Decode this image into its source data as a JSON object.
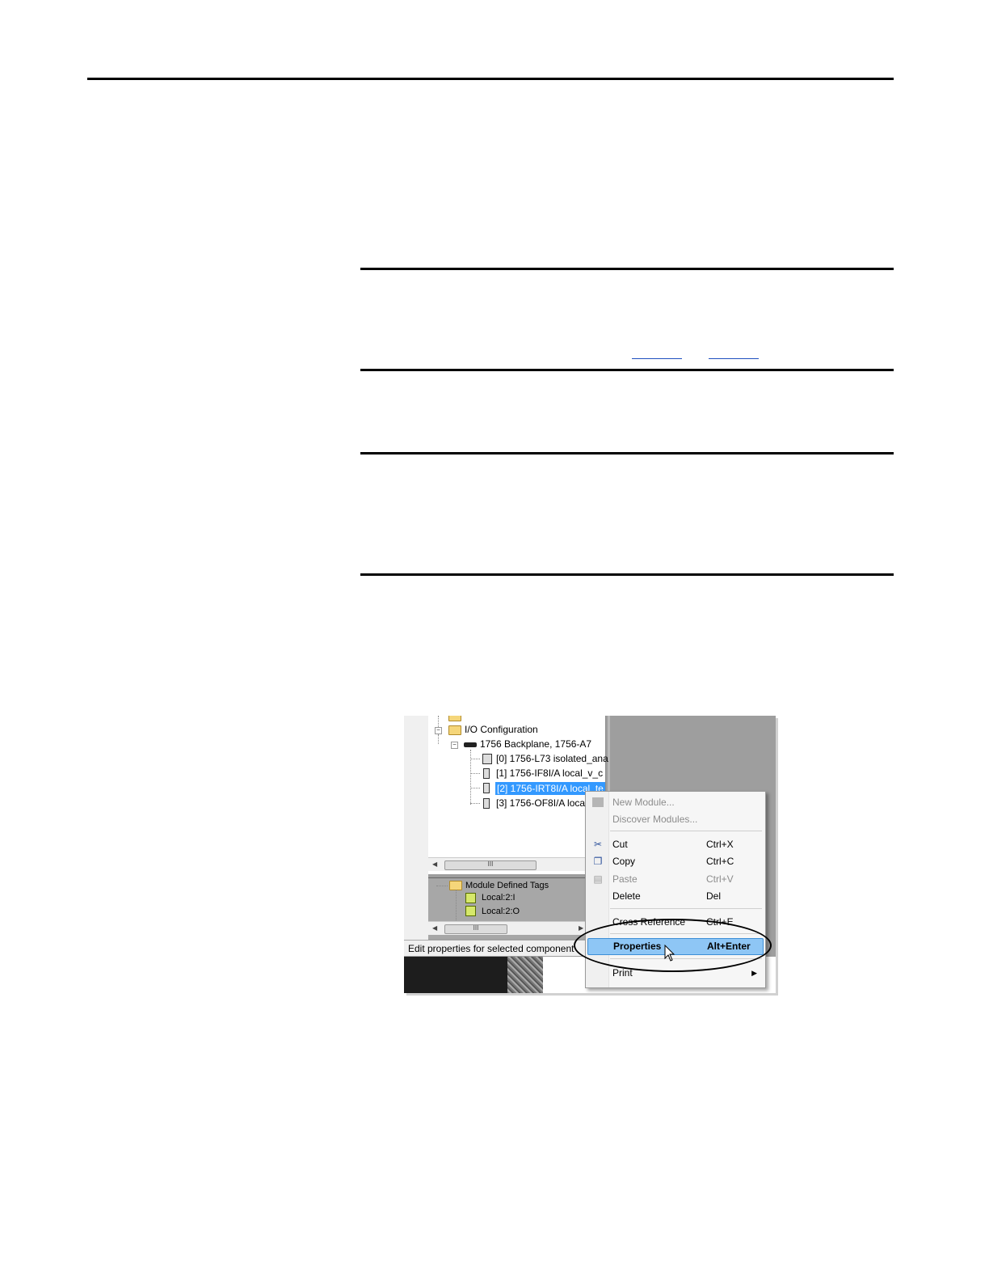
{
  "tree": {
    "io_configuration": "I/O Configuration",
    "backplane": "1756 Backplane, 1756-A7",
    "modules": [
      "[0] 1756-L73 isolated_ana",
      "[1] 1756-IF8I/A local_v_c",
      "[2] 1756-IRT8I/A local_te",
      "[3] 1756-OF8I/A loca"
    ],
    "scroll_thumb": "III"
  },
  "tags": {
    "folder": "Module Defined Tags",
    "items": [
      "Local:2:I",
      "Local:2:O"
    ]
  },
  "status_text": "Edit properties for selected component",
  "context_menu": {
    "items": [
      {
        "label": "New Module...",
        "shortcut": ""
      },
      {
        "label": "Discover Modules...",
        "shortcut": ""
      },
      {
        "label": "Cut",
        "shortcut": "Ctrl+X"
      },
      {
        "label": "Copy",
        "shortcut": "Ctrl+C"
      },
      {
        "label": "Paste",
        "shortcut": "Ctrl+V"
      },
      {
        "label": "Delete",
        "shortcut": "Del"
      },
      {
        "label": "Cross Reference",
        "shortcut": "Ctrl+E"
      },
      {
        "label": "Properties",
        "shortcut": "Alt+Enter"
      },
      {
        "label": "Print",
        "shortcut": ""
      }
    ]
  },
  "colors": {
    "selection": "#3399ff",
    "menu_highlight": "#8ec6f5"
  }
}
